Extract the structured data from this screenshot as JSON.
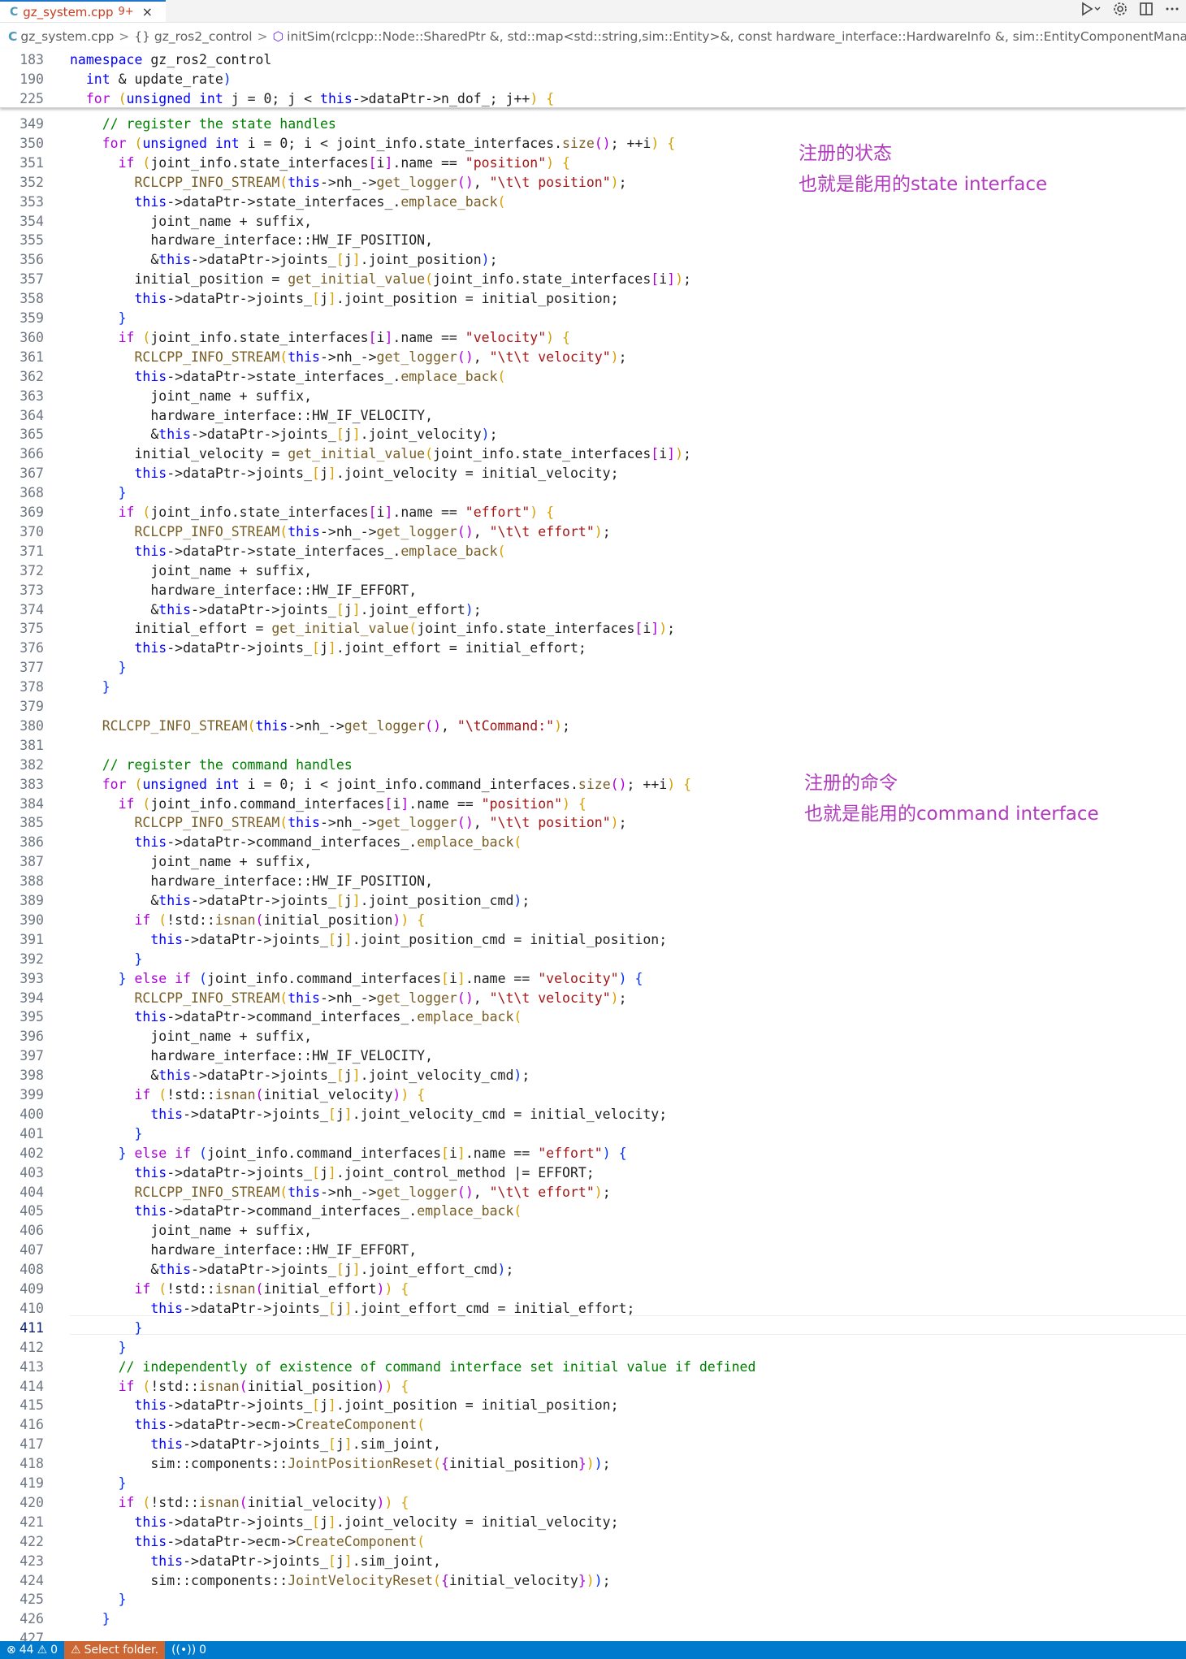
{
  "tab": {
    "file_icon": "C",
    "filename": "gz_system.cpp",
    "problems": "9+",
    "close": "×"
  },
  "breadcrumb": {
    "file": "gz_system.cpp",
    "namespace": "{} gz_ros2_control",
    "symbol": "initSim(rclcpp::Node::SharedPtr &, std::map<std::string,sim::Entity>&, const hardware_interface::HardwareInfo &, sim::EntityComponentManager &, int &"
  },
  "icons": {
    "run": "run-icon",
    "settings": "gear-icon",
    "split": "split-editor-icon",
    "more": "more-icon"
  },
  "notes": {
    "state_line1": "注册的状态",
    "state_line2": "也就是能用的state interface",
    "command_line1": "注册的命令",
    "command_line2": "也就是能用的command interface"
  },
  "editor": {
    "active_line": "411",
    "lines": [
      {
        "n": "183",
        "code": "namespace gz_ros2_control"
      },
      {
        "n": "190",
        "code": "  int & update_rate)"
      },
      {
        "n": "225",
        "code": "  for (unsigned int j = 0; j < this->dataPtr->n_dof_; j++) {"
      },
      {
        "n": "349",
        "code": "    // register the state handles"
      },
      {
        "n": "350",
        "code": "    for (unsigned int i = 0; i < joint_info.state_interfaces.size(); ++i) {"
      },
      {
        "n": "351",
        "code": "      if (joint_info.state_interfaces[i].name == \"position\") {"
      },
      {
        "n": "352",
        "code": "        RCLCPP_INFO_STREAM(this->nh_->get_logger(), \"\\t\\t position\");"
      },
      {
        "n": "353",
        "code": "        this->dataPtr->state_interfaces_.emplace_back("
      },
      {
        "n": "354",
        "code": "          joint_name + suffix,"
      },
      {
        "n": "355",
        "code": "          hardware_interface::HW_IF_POSITION,"
      },
      {
        "n": "356",
        "code": "          &this->dataPtr->joints_[j].joint_position);"
      },
      {
        "n": "357",
        "code": "        initial_position = get_initial_value(joint_info.state_interfaces[i]);"
      },
      {
        "n": "358",
        "code": "        this->dataPtr->joints_[j].joint_position = initial_position;"
      },
      {
        "n": "359",
        "code": "      }"
      },
      {
        "n": "360",
        "code": "      if (joint_info.state_interfaces[i].name == \"velocity\") {"
      },
      {
        "n": "361",
        "code": "        RCLCPP_INFO_STREAM(this->nh_->get_logger(), \"\\t\\t velocity\");"
      },
      {
        "n": "362",
        "code": "        this->dataPtr->state_interfaces_.emplace_back("
      },
      {
        "n": "363",
        "code": "          joint_name + suffix,"
      },
      {
        "n": "364",
        "code": "          hardware_interface::HW_IF_VELOCITY,"
      },
      {
        "n": "365",
        "code": "          &this->dataPtr->joints_[j].joint_velocity);"
      },
      {
        "n": "366",
        "code": "        initial_velocity = get_initial_value(joint_info.state_interfaces[i]);"
      },
      {
        "n": "367",
        "code": "        this->dataPtr->joints_[j].joint_velocity = initial_velocity;"
      },
      {
        "n": "368",
        "code": "      }"
      },
      {
        "n": "369",
        "code": "      if (joint_info.state_interfaces[i].name == \"effort\") {"
      },
      {
        "n": "370",
        "code": "        RCLCPP_INFO_STREAM(this->nh_->get_logger(), \"\\t\\t effort\");"
      },
      {
        "n": "371",
        "code": "        this->dataPtr->state_interfaces_.emplace_back("
      },
      {
        "n": "372",
        "code": "          joint_name + suffix,"
      },
      {
        "n": "373",
        "code": "          hardware_interface::HW_IF_EFFORT,"
      },
      {
        "n": "374",
        "code": "          &this->dataPtr->joints_[j].joint_effort);"
      },
      {
        "n": "375",
        "code": "        initial_effort = get_initial_value(joint_info.state_interfaces[i]);"
      },
      {
        "n": "376",
        "code": "        this->dataPtr->joints_[j].joint_effort = initial_effort;"
      },
      {
        "n": "377",
        "code": "      }"
      },
      {
        "n": "378",
        "code": "    }"
      },
      {
        "n": "379",
        "code": ""
      },
      {
        "n": "380",
        "code": "    RCLCPP_INFO_STREAM(this->nh_->get_logger(), \"\\tCommand:\");"
      },
      {
        "n": "381",
        "code": ""
      },
      {
        "n": "382",
        "code": "    // register the command handles"
      },
      {
        "n": "383",
        "code": "    for (unsigned int i = 0; i < joint_info.command_interfaces.size(); ++i) {"
      },
      {
        "n": "384",
        "code": "      if (joint_info.command_interfaces[i].name == \"position\") {"
      },
      {
        "n": "385",
        "code": "        RCLCPP_INFO_STREAM(this->nh_->get_logger(), \"\\t\\t position\");"
      },
      {
        "n": "386",
        "code": "        this->dataPtr->command_interfaces_.emplace_back("
      },
      {
        "n": "387",
        "code": "          joint_name + suffix,"
      },
      {
        "n": "388",
        "code": "          hardware_interface::HW_IF_POSITION,"
      },
      {
        "n": "389",
        "code": "          &this->dataPtr->joints_[j].joint_position_cmd);"
      },
      {
        "n": "390",
        "code": "        if (!std::isnan(initial_position)) {"
      },
      {
        "n": "391",
        "code": "          this->dataPtr->joints_[j].joint_position_cmd = initial_position;"
      },
      {
        "n": "392",
        "code": "        }"
      },
      {
        "n": "393",
        "code": "      } else if (joint_info.command_interfaces[i].name == \"velocity\") {"
      },
      {
        "n": "394",
        "code": "        RCLCPP_INFO_STREAM(this->nh_->get_logger(), \"\\t\\t velocity\");"
      },
      {
        "n": "395",
        "code": "        this->dataPtr->command_interfaces_.emplace_back("
      },
      {
        "n": "396",
        "code": "          joint_name + suffix,"
      },
      {
        "n": "397",
        "code": "          hardware_interface::HW_IF_VELOCITY,"
      },
      {
        "n": "398",
        "code": "          &this->dataPtr->joints_[j].joint_velocity_cmd);"
      },
      {
        "n": "399",
        "code": "        if (!std::isnan(initial_velocity)) {"
      },
      {
        "n": "400",
        "code": "          this->dataPtr->joints_[j].joint_velocity_cmd = initial_velocity;"
      },
      {
        "n": "401",
        "code": "        }"
      },
      {
        "n": "402",
        "code": "      } else if (joint_info.command_interfaces[i].name == \"effort\") {"
      },
      {
        "n": "403",
        "code": "        this->dataPtr->joints_[j].joint_control_method |= EFFORT;"
      },
      {
        "n": "404",
        "code": "        RCLCPP_INFO_STREAM(this->nh_->get_logger(), \"\\t\\t effort\");"
      },
      {
        "n": "405",
        "code": "        this->dataPtr->command_interfaces_.emplace_back("
      },
      {
        "n": "406",
        "code": "          joint_name + suffix,"
      },
      {
        "n": "407",
        "code": "          hardware_interface::HW_IF_EFFORT,"
      },
      {
        "n": "408",
        "code": "          &this->dataPtr->joints_[j].joint_effort_cmd);"
      },
      {
        "n": "409",
        "code": "        if (!std::isnan(initial_effort)) {"
      },
      {
        "n": "410",
        "code": "          this->dataPtr->joints_[j].joint_effort_cmd = initial_effort;"
      },
      {
        "n": "411",
        "code": "        }"
      },
      {
        "n": "412",
        "code": "      }"
      },
      {
        "n": "413",
        "code": "      // independently of existence of command interface set initial value if defined"
      },
      {
        "n": "414",
        "code": "      if (!std::isnan(initial_position)) {"
      },
      {
        "n": "415",
        "code": "        this->dataPtr->joints_[j].joint_position = initial_position;"
      },
      {
        "n": "416",
        "code": "        this->dataPtr->ecm->CreateComponent("
      },
      {
        "n": "417",
        "code": "          this->dataPtr->joints_[j].sim_joint,"
      },
      {
        "n": "418",
        "code": "          sim::components::JointPositionReset({initial_position}));"
      },
      {
        "n": "419",
        "code": "      }"
      },
      {
        "n": "420",
        "code": "      if (!std::isnan(initial_velocity)) {"
      },
      {
        "n": "421",
        "code": "        this->dataPtr->joints_[j].joint_velocity = initial_velocity;"
      },
      {
        "n": "422",
        "code": "        this->dataPtr->ecm->CreateComponent("
      },
      {
        "n": "423",
        "code": "          this->dataPtr->joints_[j].sim_joint,"
      },
      {
        "n": "424",
        "code": "          sim::components::JointVelocityReset({initial_velocity}));"
      },
      {
        "n": "425",
        "code": "      }"
      },
      {
        "n": "426",
        "code": "    }"
      },
      {
        "n": "427",
        "code": ""
      }
    ]
  },
  "statusbar": {
    "errors": "44",
    "warnings": "0",
    "folder": "Select folder.",
    "ports": "0"
  }
}
